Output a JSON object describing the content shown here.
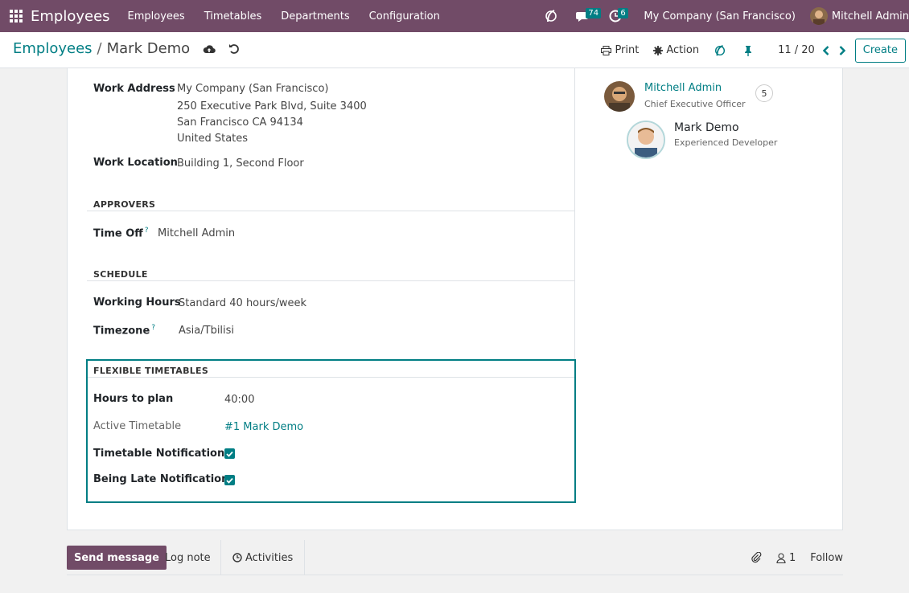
{
  "navbar": {
    "brand": "Employees",
    "menus": [
      "Employees",
      "Timetables",
      "Departments",
      "Configuration"
    ],
    "messages_count": "74",
    "activities_count": "6",
    "company": "My Company (San Francisco)",
    "user": "Mitchell Admin"
  },
  "control_panel": {
    "breadcrumb_parent": "Employees",
    "breadcrumb_sep": "/",
    "breadcrumb_current": "Mark Demo",
    "print_label": "Print",
    "action_label": "Action",
    "pager": "11 / 20",
    "create_label": "Create"
  },
  "form": {
    "work_address_label": "Work Address",
    "work_address_lines": [
      "My Company (San Francisco)",
      "250 Executive Park Blvd, Suite 3400",
      "San Francisco CA 94134",
      "United States"
    ],
    "work_location_label": "Work Location",
    "work_location_value": "Building 1, Second Floor",
    "approvers_title": "APPROVERS",
    "time_off_label": "Time Off",
    "help_mark": "?",
    "time_off_value": "Mitchell Admin",
    "schedule_title": "SCHEDULE",
    "working_hours_label": "Working Hours",
    "working_hours_value": "Standard 40 hours/week",
    "timezone_label": "Timezone",
    "timezone_value": "Asia/Tbilisi",
    "flex_title": "FLEXIBLE TIMETABLES",
    "hours_to_plan_label": "Hours to plan",
    "hours_to_plan_value": "40:00",
    "active_timetable_label": "Active Timetable",
    "active_timetable_value": "#1 Mark Demo",
    "timetable_notifications_label": "Timetable Notifications",
    "timetable_notifications_checked": true,
    "being_late_notifications_label": "Being Late Notifications",
    "being_late_notifications_checked": true
  },
  "org_chart": {
    "manager_name": "Mitchell Admin",
    "manager_title": "Chief Executive Officer",
    "manager_count": "5",
    "employee_name": "Mark Demo",
    "employee_title": "Experienced Developer"
  },
  "chatter": {
    "send_message": "Send message",
    "log_note": "Log note",
    "activities": "Activities",
    "followers_count": "1",
    "follow": "Follow"
  },
  "colors": {
    "brand": "#714b67",
    "accent": "#017e84"
  }
}
